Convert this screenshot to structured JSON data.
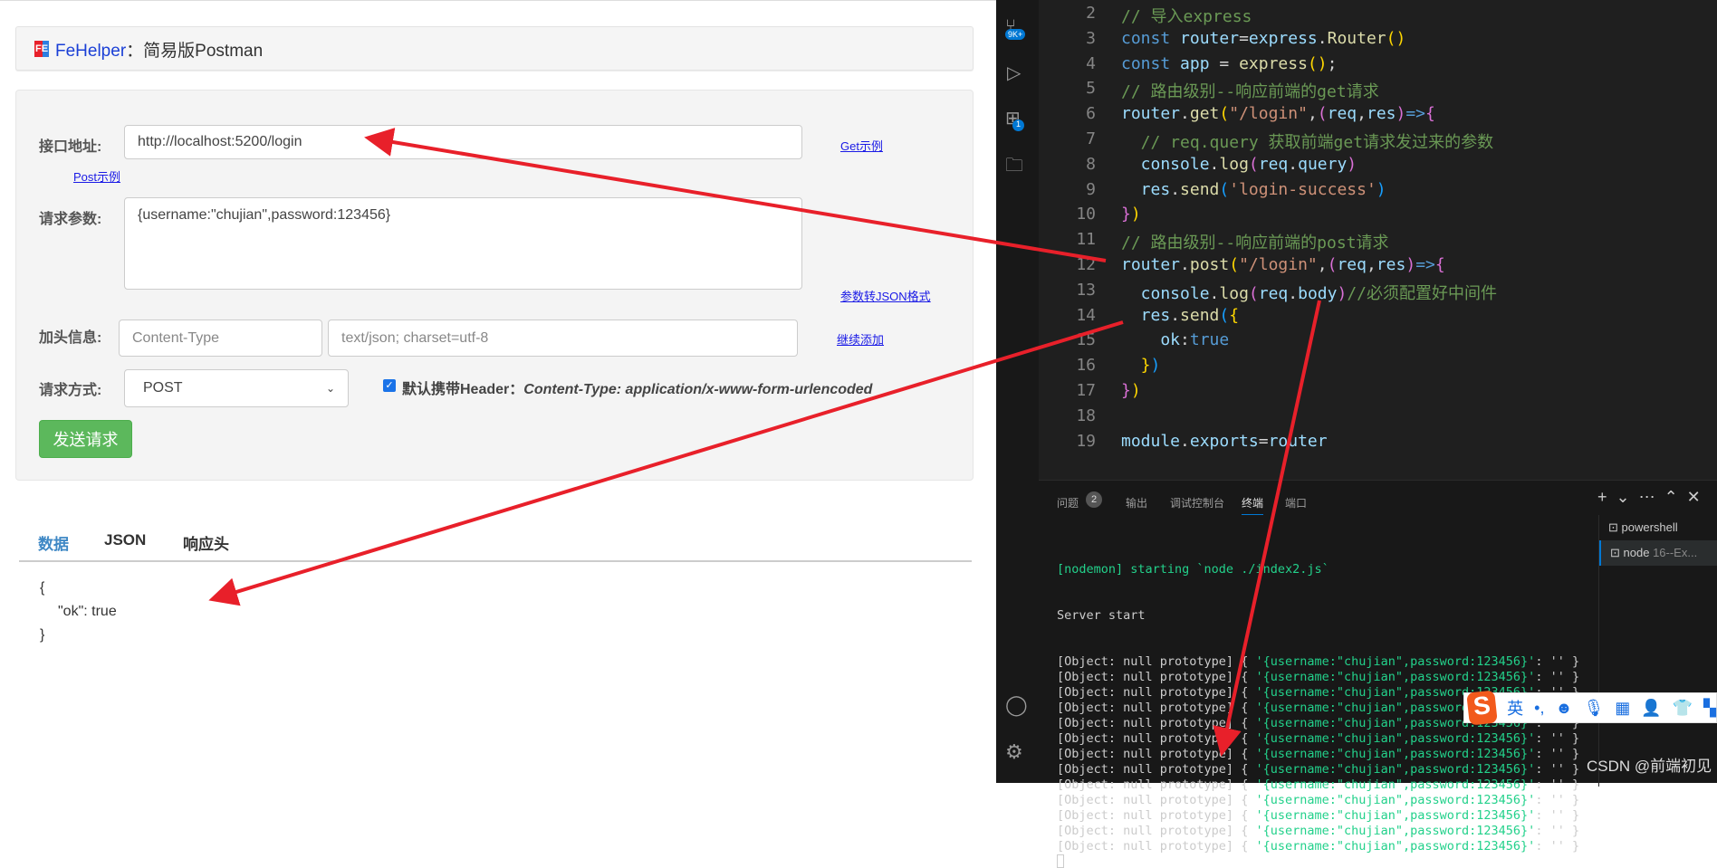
{
  "fehelper": {
    "logo": "FE",
    "brand": "FeHelper",
    "title_sep": "：",
    "title": "简易版Postman",
    "url_label": "接口地址:",
    "url_value": "http://localhost:5200/login",
    "get_example": "Get示例",
    "post_example": "Post示例",
    "params_label": "请求参数:",
    "params_value": "{username:\"chujian\",password:123456}",
    "to_json": "参数转JSON格式",
    "header_label": "加头信息:",
    "header_key_placeholder": "Content-Type",
    "header_value_placeholder": "text/json; charset=utf-8",
    "add_more": "继续添加",
    "method_label": "请求方式:",
    "method_value": "POST",
    "default_header_label": "默认携带Header：",
    "default_header_value": "Content-Type: application/x-www-form-urlencoded",
    "default_header_checked": true,
    "send": "发送请求",
    "tabs": [
      "数据",
      "JSON",
      "响应头"
    ],
    "active_tab": "数据",
    "response": [
      "{",
      "\"ok\": true",
      "}"
    ]
  },
  "editor": {
    "badges": {
      "scm": "9K+",
      "extensions": "1"
    },
    "lines": [
      {
        "n": "2",
        "t": [
          [
            "// 导入express",
            "c"
          ]
        ]
      },
      {
        "n": "3",
        "t": [
          [
            "const ",
            "k"
          ],
          [
            "router",
            "v"
          ],
          [
            "=",
            "w"
          ],
          [
            "express",
            "v"
          ],
          [
            ".",
            "w"
          ],
          [
            "Router",
            "f"
          ],
          [
            "()",
            "y"
          ]
        ]
      },
      {
        "n": "4",
        "t": [
          [
            "const ",
            "k"
          ],
          [
            "app",
            "v"
          ],
          [
            " = ",
            "w"
          ],
          [
            "express",
            "f"
          ],
          [
            "()",
            "y"
          ],
          [
            ";",
            "w"
          ]
        ]
      },
      {
        "n": "5",
        "t": [
          [
            "// 路由级别--响应前端的get请求",
            "c"
          ]
        ]
      },
      {
        "n": "6",
        "t": [
          [
            "router",
            "v"
          ],
          [
            ".",
            "w"
          ],
          [
            "get",
            "f"
          ],
          [
            "(",
            "y"
          ],
          [
            "\"/login\"",
            "s"
          ],
          [
            ",",
            "w"
          ],
          [
            "(",
            "p"
          ],
          [
            "req",
            "v"
          ],
          [
            ",",
            "w"
          ],
          [
            "res",
            "v"
          ],
          [
            ")",
            "p"
          ],
          [
            "=>",
            "k"
          ],
          [
            "{",
            "p"
          ]
        ]
      },
      {
        "n": "7",
        "t": [
          [
            "  // req.query 获取前端get请求发过来的参数",
            "c"
          ]
        ]
      },
      {
        "n": "8",
        "t": [
          [
            "  console",
            "v"
          ],
          [
            ".",
            "w"
          ],
          [
            "log",
            "f"
          ],
          [
            "(",
            "p"
          ],
          [
            "req",
            "v"
          ],
          [
            ".",
            "w"
          ],
          [
            "query",
            "v"
          ],
          [
            ")",
            "p"
          ]
        ]
      },
      {
        "n": "9",
        "t": [
          [
            "  res",
            "v"
          ],
          [
            ".",
            "w"
          ],
          [
            "send",
            "f"
          ],
          [
            "(",
            "bl"
          ],
          [
            "'login-success'",
            "s"
          ],
          [
            ")",
            "bl"
          ]
        ]
      },
      {
        "n": "10",
        "t": [
          [
            "}",
            "p"
          ],
          [
            ")",
            "y"
          ]
        ]
      },
      {
        "n": "11",
        "t": [
          [
            "// 路由级别--响应前端的post请求",
            "c"
          ]
        ]
      },
      {
        "n": "12",
        "t": [
          [
            "router",
            "v"
          ],
          [
            ".",
            "w"
          ],
          [
            "post",
            "f"
          ],
          [
            "(",
            "y"
          ],
          [
            "\"/login\"",
            "s"
          ],
          [
            ",",
            "w"
          ],
          [
            "(",
            "p"
          ],
          [
            "req",
            "v"
          ],
          [
            ",",
            "w"
          ],
          [
            "res",
            "v"
          ],
          [
            ")",
            "p"
          ],
          [
            "=>",
            "k"
          ],
          [
            "{",
            "p"
          ]
        ]
      },
      {
        "n": "13",
        "t": [
          [
            "  console",
            "v"
          ],
          [
            ".",
            "w"
          ],
          [
            "log",
            "f"
          ],
          [
            "(",
            "p"
          ],
          [
            "req",
            "v"
          ],
          [
            ".",
            "w"
          ],
          [
            "body",
            "v"
          ],
          [
            ")",
            "p"
          ],
          [
            "//必须配置好中间件",
            "c"
          ]
        ]
      },
      {
        "n": "14",
        "t": [
          [
            "  res",
            "v"
          ],
          [
            ".",
            "w"
          ],
          [
            "send",
            "f"
          ],
          [
            "(",
            "bl"
          ],
          [
            "{",
            "y"
          ]
        ]
      },
      {
        "n": "15",
        "t": [
          [
            "    ok",
            "v"
          ],
          [
            ":",
            "w"
          ],
          [
            "true",
            "k"
          ]
        ]
      },
      {
        "n": "16",
        "t": [
          [
            "  }",
            "y"
          ],
          [
            ")",
            "bl"
          ]
        ]
      },
      {
        "n": "17",
        "t": [
          [
            "}",
            "p"
          ],
          [
            ")",
            "y"
          ]
        ]
      },
      {
        "n": "18",
        "t": []
      },
      {
        "n": "19",
        "t": [
          [
            "module",
            "v"
          ],
          [
            ".",
            "w"
          ],
          [
            "exports",
            "v"
          ],
          [
            "=",
            "w"
          ],
          [
            "router",
            "v"
          ]
        ]
      }
    ]
  },
  "panel": {
    "tabs": [
      "问题",
      "输出",
      "调试控制台",
      "终端",
      "端口"
    ],
    "problems_count": "2",
    "active_tab": "终端",
    "terminals": [
      "powershell",
      "node",
      "16--Ex..."
    ],
    "nodemon": "[nodemon] starting `node ./index2.js`",
    "server": "Server start",
    "log_prefix": "[Object: null prototype] { ",
    "log_value": "'{username:\"chujian\",password:123456}'",
    "log_suffix": ": '' }",
    "log_count": 13
  },
  "ime": {
    "lang": "英",
    "punct": "•,"
  },
  "watermark": "CSDN @前端初见",
  "colors": {
    "arrow": "#e8202a",
    "send_button": "#5cb85c",
    "active_tab": "#3f88c5"
  }
}
